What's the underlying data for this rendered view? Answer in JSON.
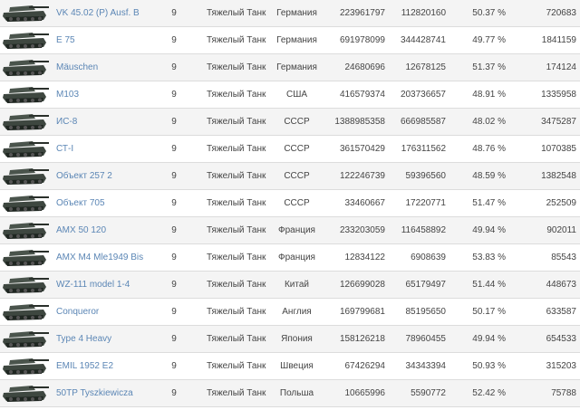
{
  "tank_icon": "heavy-tank-silhouette",
  "colors": {
    "link": "#5b86b5",
    "tank_body": "#3e4740",
    "tank_dark": "#1f2621",
    "row_alt": "#f4f4f4",
    "divider": "#dcdcdc"
  },
  "rows": [
    {
      "name": "VK 45.02 (P) Ausf. B",
      "tier": "9",
      "type": "Тяжелый Танк",
      "nation": "Германия",
      "battles": "223961797",
      "wins": "112820160",
      "pct": "50.37 %",
      "total": "720683"
    },
    {
      "name": "E 75",
      "tier": "9",
      "type": "Тяжелый Танк",
      "nation": "Германия",
      "battles": "691978099",
      "wins": "344428741",
      "pct": "49.77 %",
      "total": "1841159"
    },
    {
      "name": "Mäuschen",
      "tier": "9",
      "type": "Тяжелый Танк",
      "nation": "Германия",
      "battles": "24680696",
      "wins": "12678125",
      "pct": "51.37 %",
      "total": "174124"
    },
    {
      "name": "M103",
      "tier": "9",
      "type": "Тяжелый Танк",
      "nation": "США",
      "battles": "416579374",
      "wins": "203736657",
      "pct": "48.91 %",
      "total": "1335958"
    },
    {
      "name": "ИС-8",
      "tier": "9",
      "type": "Тяжелый Танк",
      "nation": "СССР",
      "battles": "1388985358",
      "wins": "666985587",
      "pct": "48.02 %",
      "total": "3475287"
    },
    {
      "name": "СТ-I",
      "tier": "9",
      "type": "Тяжелый Танк",
      "nation": "СССР",
      "battles": "361570429",
      "wins": "176311562",
      "pct": "48.76 %",
      "total": "1070385"
    },
    {
      "name": "Объект 257 2",
      "tier": "9",
      "type": "Тяжелый Танк",
      "nation": "СССР",
      "battles": "122246739",
      "wins": "59396560",
      "pct": "48.59 %",
      "total": "1382548"
    },
    {
      "name": "Объект 705",
      "tier": "9",
      "type": "Тяжелый Танк",
      "nation": "СССР",
      "battles": "33460667",
      "wins": "17220771",
      "pct": "51.47 %",
      "total": "252509"
    },
    {
      "name": "AMX 50 120",
      "tier": "9",
      "type": "Тяжелый Танк",
      "nation": "Франция",
      "battles": "233203059",
      "wins": "116458892",
      "pct": "49.94 %",
      "total": "902011"
    },
    {
      "name": "AMX M4 Mle1949 Bis",
      "tier": "9",
      "type": "Тяжелый Танк",
      "nation": "Франция",
      "battles": "12834122",
      "wins": "6908639",
      "pct": "53.83 %",
      "total": "85543"
    },
    {
      "name": "WZ-111 model 1-4",
      "tier": "9",
      "type": "Тяжелый Танк",
      "nation": "Китай",
      "battles": "126699028",
      "wins": "65179497",
      "pct": "51.44 %",
      "total": "448673"
    },
    {
      "name": "Conqueror",
      "tier": "9",
      "type": "Тяжелый Танк",
      "nation": "Англия",
      "battles": "169799681",
      "wins": "85195650",
      "pct": "50.17 %",
      "total": "633587"
    },
    {
      "name": "Type 4 Heavy",
      "tier": "9",
      "type": "Тяжелый Танк",
      "nation": "Япония",
      "battles": "158126218",
      "wins": "78960455",
      "pct": "49.94 %",
      "total": "654533"
    },
    {
      "name": "EMIL 1952 E2",
      "tier": "9",
      "type": "Тяжелый Танк",
      "nation": "Швеция",
      "battles": "67426294",
      "wins": "34343394",
      "pct": "50.93 %",
      "total": "315203"
    },
    {
      "name": "50TP Tyszkiewicza",
      "tier": "9",
      "type": "Тяжелый Танк",
      "nation": "Польша",
      "battles": "10665996",
      "wins": "5590772",
      "pct": "52.42 %",
      "total": "75788"
    }
  ]
}
